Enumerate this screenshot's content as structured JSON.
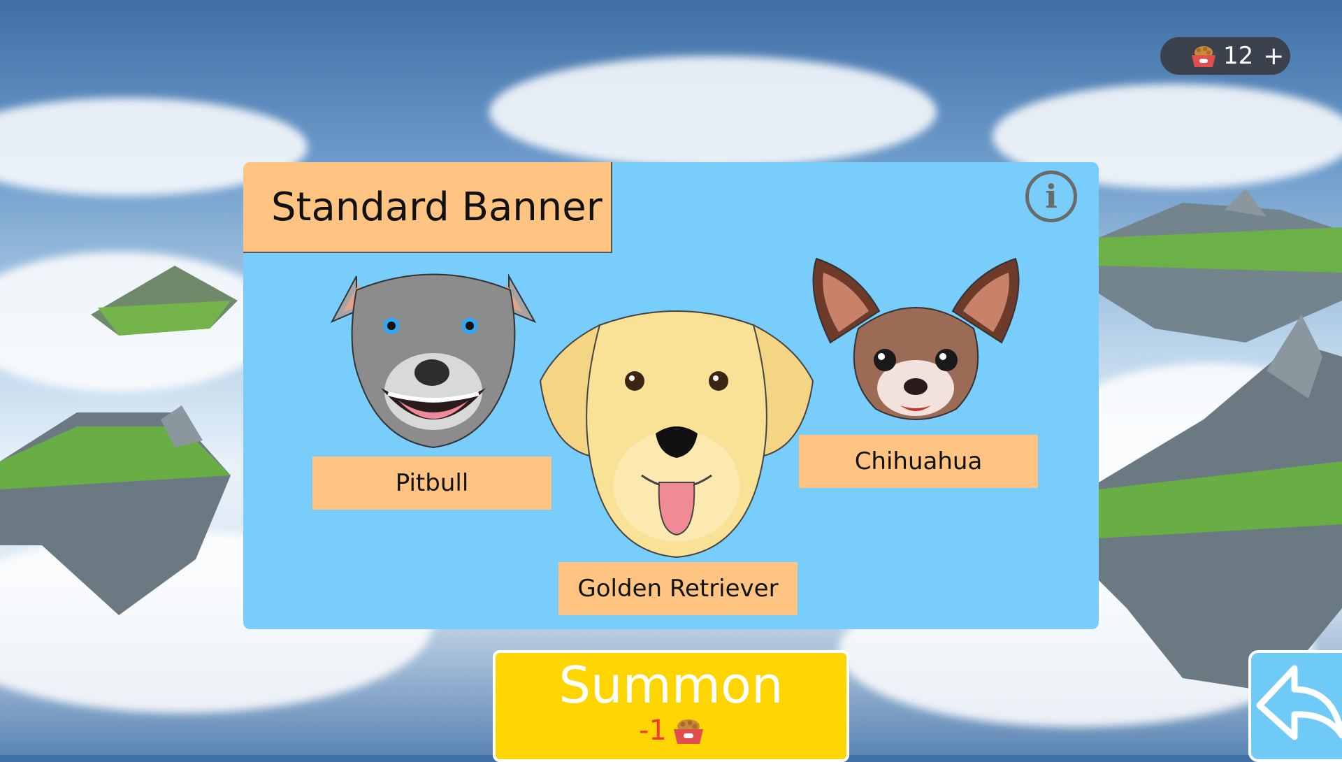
{
  "currency": {
    "icon": "dog-food-bowl-icon",
    "count": "12",
    "plus_label": "+"
  },
  "banner": {
    "title": "Standard Banner",
    "info_icon": "info-icon",
    "info_glyph": "i",
    "dogs": [
      {
        "name": "Pitbull"
      },
      {
        "name": "Golden Retriever"
      },
      {
        "name": "Chihuahua"
      }
    ]
  },
  "summon": {
    "label": "Summon",
    "cost": "-1",
    "cost_icon": "dog-food-bowl-icon"
  },
  "back_button": {
    "icon": "back-arrow-icon"
  },
  "colors": {
    "banner_bg": "#79cdfb",
    "label_bg": "#ffc481",
    "summon_bg": "#ffd500",
    "cost_text": "#f03a3a",
    "back_bg": "#6fcaf6"
  }
}
